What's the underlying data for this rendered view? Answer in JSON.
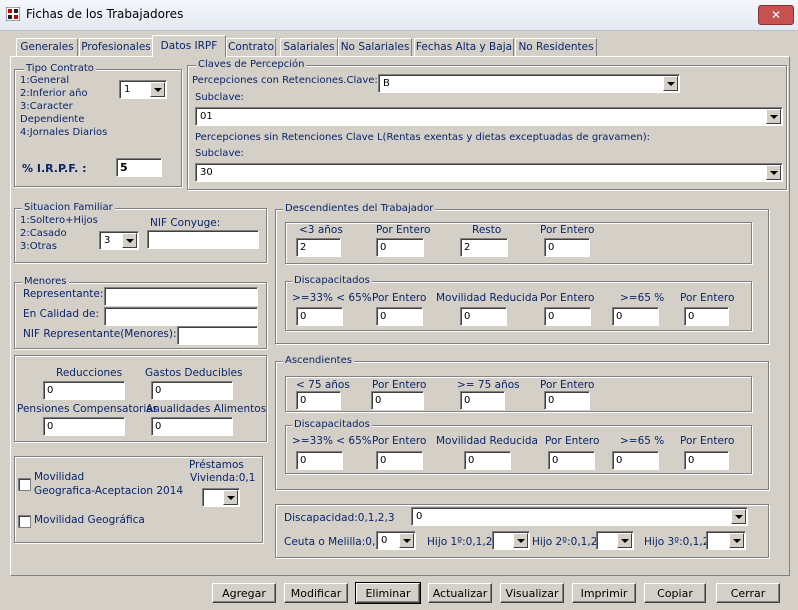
{
  "window": {
    "title": "Fichas de los Trabajadores",
    "close_glyph": "✕"
  },
  "tabs": [
    {
      "label": "Generales"
    },
    {
      "label": "Profesionales"
    },
    {
      "label": "Datos IRPF"
    },
    {
      "label": "Contrato"
    },
    {
      "label": "Salariales"
    },
    {
      "label": "No Salariales"
    },
    {
      "label": "Fechas Alta y Baja"
    },
    {
      "label": "No Residentes"
    }
  ],
  "active_tab": "Datos IRPF",
  "tipo_contrato": {
    "title": "Tipo Contrato",
    "options": [
      "1:General",
      "2:Inferior año",
      "3:Caracter",
      "Dependiente",
      "4:Jornales Diarios"
    ],
    "value": "1",
    "irpf_label": "% I.R.P.F. :",
    "irpf_value": "5"
  },
  "claves": {
    "title": "Claves de Percepción",
    "con_ret_label": "Percepciones con Retenciones.Clave:",
    "con_ret_value": "B",
    "subclave1_label": "Subclave:",
    "subclave1_value": "01",
    "sin_ret_label": "Percepciones sin Retenciones Clave L(Rentas exentas y dietas exceptuadas de gravamen):",
    "subclave2_label": "Subclave:",
    "subclave2_value": "30"
  },
  "familiar": {
    "title": "Situacion Familiar",
    "options": [
      "1:Soltero+Hijos",
      "2:Casado",
      "3:Otras"
    ],
    "value": "3",
    "nif_conyuge_label": "NIF Conyuge:",
    "nif_conyuge_value": ""
  },
  "menores": {
    "title": "Menores",
    "representante_label": "Representante:",
    "calidad_label": "En Calidad de:",
    "nif_rep_label": "NIF Representante(Menores):"
  },
  "reducciones": {
    "reducciones_label": "Reducciones",
    "reducciones_value": "0",
    "gastos_label": "Gastos Deducibles",
    "gastos_value": "0",
    "pensiones_label": "Pensiones Compensatorias",
    "pensiones_value": "0",
    "anualidades_label": "Anualidades Alimentos",
    "anualidades_value": "0"
  },
  "movilidad": {
    "aceptacion_label_1": "Movilidad",
    "aceptacion_label_2": "Geografica-Aceptacion 2014",
    "geografica_label": "Movilidad Geográfica",
    "prestamos_label_1": "Préstamos",
    "prestamos_label_2": "Vivienda:0,1",
    "prestamos_value": ""
  },
  "descendientes": {
    "title": "Descendientes del Trabajador",
    "menor3_label": "<3 años",
    "menor3_value": "2",
    "entero1_label": "Por Entero",
    "entero1_value": "0",
    "resto_label": "Resto",
    "resto_value": "2",
    "entero2_label": "Por Entero",
    "entero2_value": "0",
    "disc_title": "Discapacitados",
    "disc": [
      {
        "label": ">=33% < 65%",
        "value": "0"
      },
      {
        "label": "Por Entero",
        "value": "0"
      },
      {
        "label": "Movilidad Reducida",
        "value": "0"
      },
      {
        "label": "Por Entero",
        "value": "0"
      },
      {
        "label": ">=65 %",
        "value": "0"
      },
      {
        "label": "Por Entero",
        "value": "0"
      }
    ]
  },
  "ascendientes": {
    "title": "Ascendientes",
    "menor75_label": "< 75 años",
    "menor75_value": "0",
    "entero1_label": "Por Entero",
    "entero1_value": "0",
    "mayor75_label": ">= 75 años",
    "mayor75_value": "0",
    "entero2_label": "Por Entero",
    "entero2_value": "0",
    "disc_title": "Discapacitados",
    "disc": [
      {
        "label": ">=33% < 65%",
        "value": "0"
      },
      {
        "label": "Por Entero",
        "value": "0"
      },
      {
        "label": "Movilidad Reducida",
        "value": "0"
      },
      {
        "label": "Por Entero",
        "value": "0"
      },
      {
        "label": ">=65 %",
        "value": "0"
      },
      {
        "label": "Por Entero",
        "value": "0"
      }
    ]
  },
  "otros": {
    "discapacidad_label": "Discapacidad:0,1,2,3",
    "discapacidad_value": "0",
    "ceuta_label": "Ceuta o Melilla:0,1",
    "ceuta_value": "0",
    "hijo1_label": "Hijo 1º:0,1,2",
    "hijo2_label": "Hijo 2º:0,1,2",
    "hijo3_label": "Hijo 3º:0,1,2"
  },
  "buttons": {
    "agregar": "Agregar",
    "modificar": "Modificar",
    "eliminar": "Eliminar",
    "actualizar": "Actualizar",
    "visualizar": "Visualizar",
    "imprimir": "Imprimir",
    "copiar": "Copiar",
    "cerrar": "Cerrar"
  }
}
